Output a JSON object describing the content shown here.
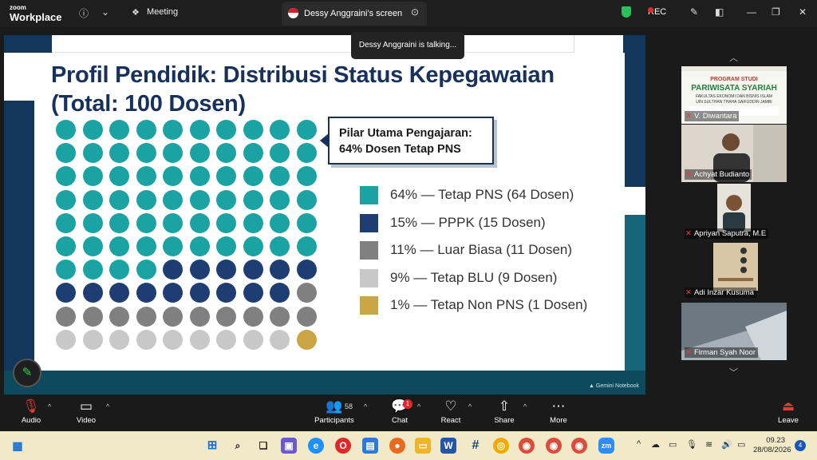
{
  "window": {
    "brand_top": "zoom",
    "brand_bottom": "Workplace",
    "meeting_tab": "Meeting",
    "screen_tab": "Dessy Anggraini's screen",
    "rec_label": "REC"
  },
  "talking_indicator": "Dessy Anggraini is talking...",
  "slide": {
    "title_line1": "Profil Pendidik: Distribusi Status Kepegawaian",
    "title_line2": "(Total: 100 Dosen)",
    "callout_line1": "Pilar Utama Pengajaran:",
    "callout_line2": "64% Dosen Tetap PNS",
    "watermark": "Gemini Notebook",
    "legend": [
      {
        "text": "64% — Tetap PNS (64 Dosen)",
        "color": "#1ba3a3"
      },
      {
        "text": "15% — PPPK (15 Dosen)",
        "color": "#1e3e73"
      },
      {
        "text": "11% — Luar Biasa (11 Dosen)",
        "color": "#808080"
      },
      {
        "text": "9% — Tetap BLU (9 Dosen)",
        "color": "#c8c8c8"
      },
      {
        "text": "1% — Tetap Non PNS (1 Dosen)",
        "color": "#c9a544"
      }
    ]
  },
  "chart_data": {
    "type": "waffle",
    "title": "Profil Pendidik: Distribusi Status Kepegawaian (Total: 100 Dosen)",
    "total": 100,
    "grid": {
      "rows": 10,
      "cols": 10
    },
    "categories": [
      "Tetap PNS",
      "PPPK",
      "Luar Biasa",
      "Tetap BLU",
      "Tetap Non PNS"
    ],
    "values": [
      64,
      15,
      11,
      9,
      1
    ],
    "colors": [
      "#1ba3a3",
      "#1e3e73",
      "#808080",
      "#c8c8c8",
      "#c9a544"
    ]
  },
  "participants_panel": {
    "tiles": [
      {
        "name": "V. Diwantara"
      },
      {
        "name": "Achyat Budianto"
      },
      {
        "name": "Apriyan Saputra, M.E"
      },
      {
        "name": "Adi Inzar Kusuma"
      },
      {
        "name": "Firman Syah Noor"
      }
    ],
    "banner_text": "PROGRAM STUDI\nPARIWISATA SYARIAH\nFAKULTAS EKONOMI DAN BISNIS ISLAM\nUIN SULTHAN THAHA SAIFUDDIN JAMBI"
  },
  "toolbar": {
    "audio": "Audio",
    "video": "Video",
    "participants": "Participants",
    "participants_count": "58",
    "chat": "Chat",
    "chat_badge": "1",
    "react": "React",
    "share": "Share",
    "more": "More",
    "leave": "Leave"
  },
  "taskbar": {
    "time": "09.23",
    "date": "28/08/2026",
    "notifications": "4"
  }
}
